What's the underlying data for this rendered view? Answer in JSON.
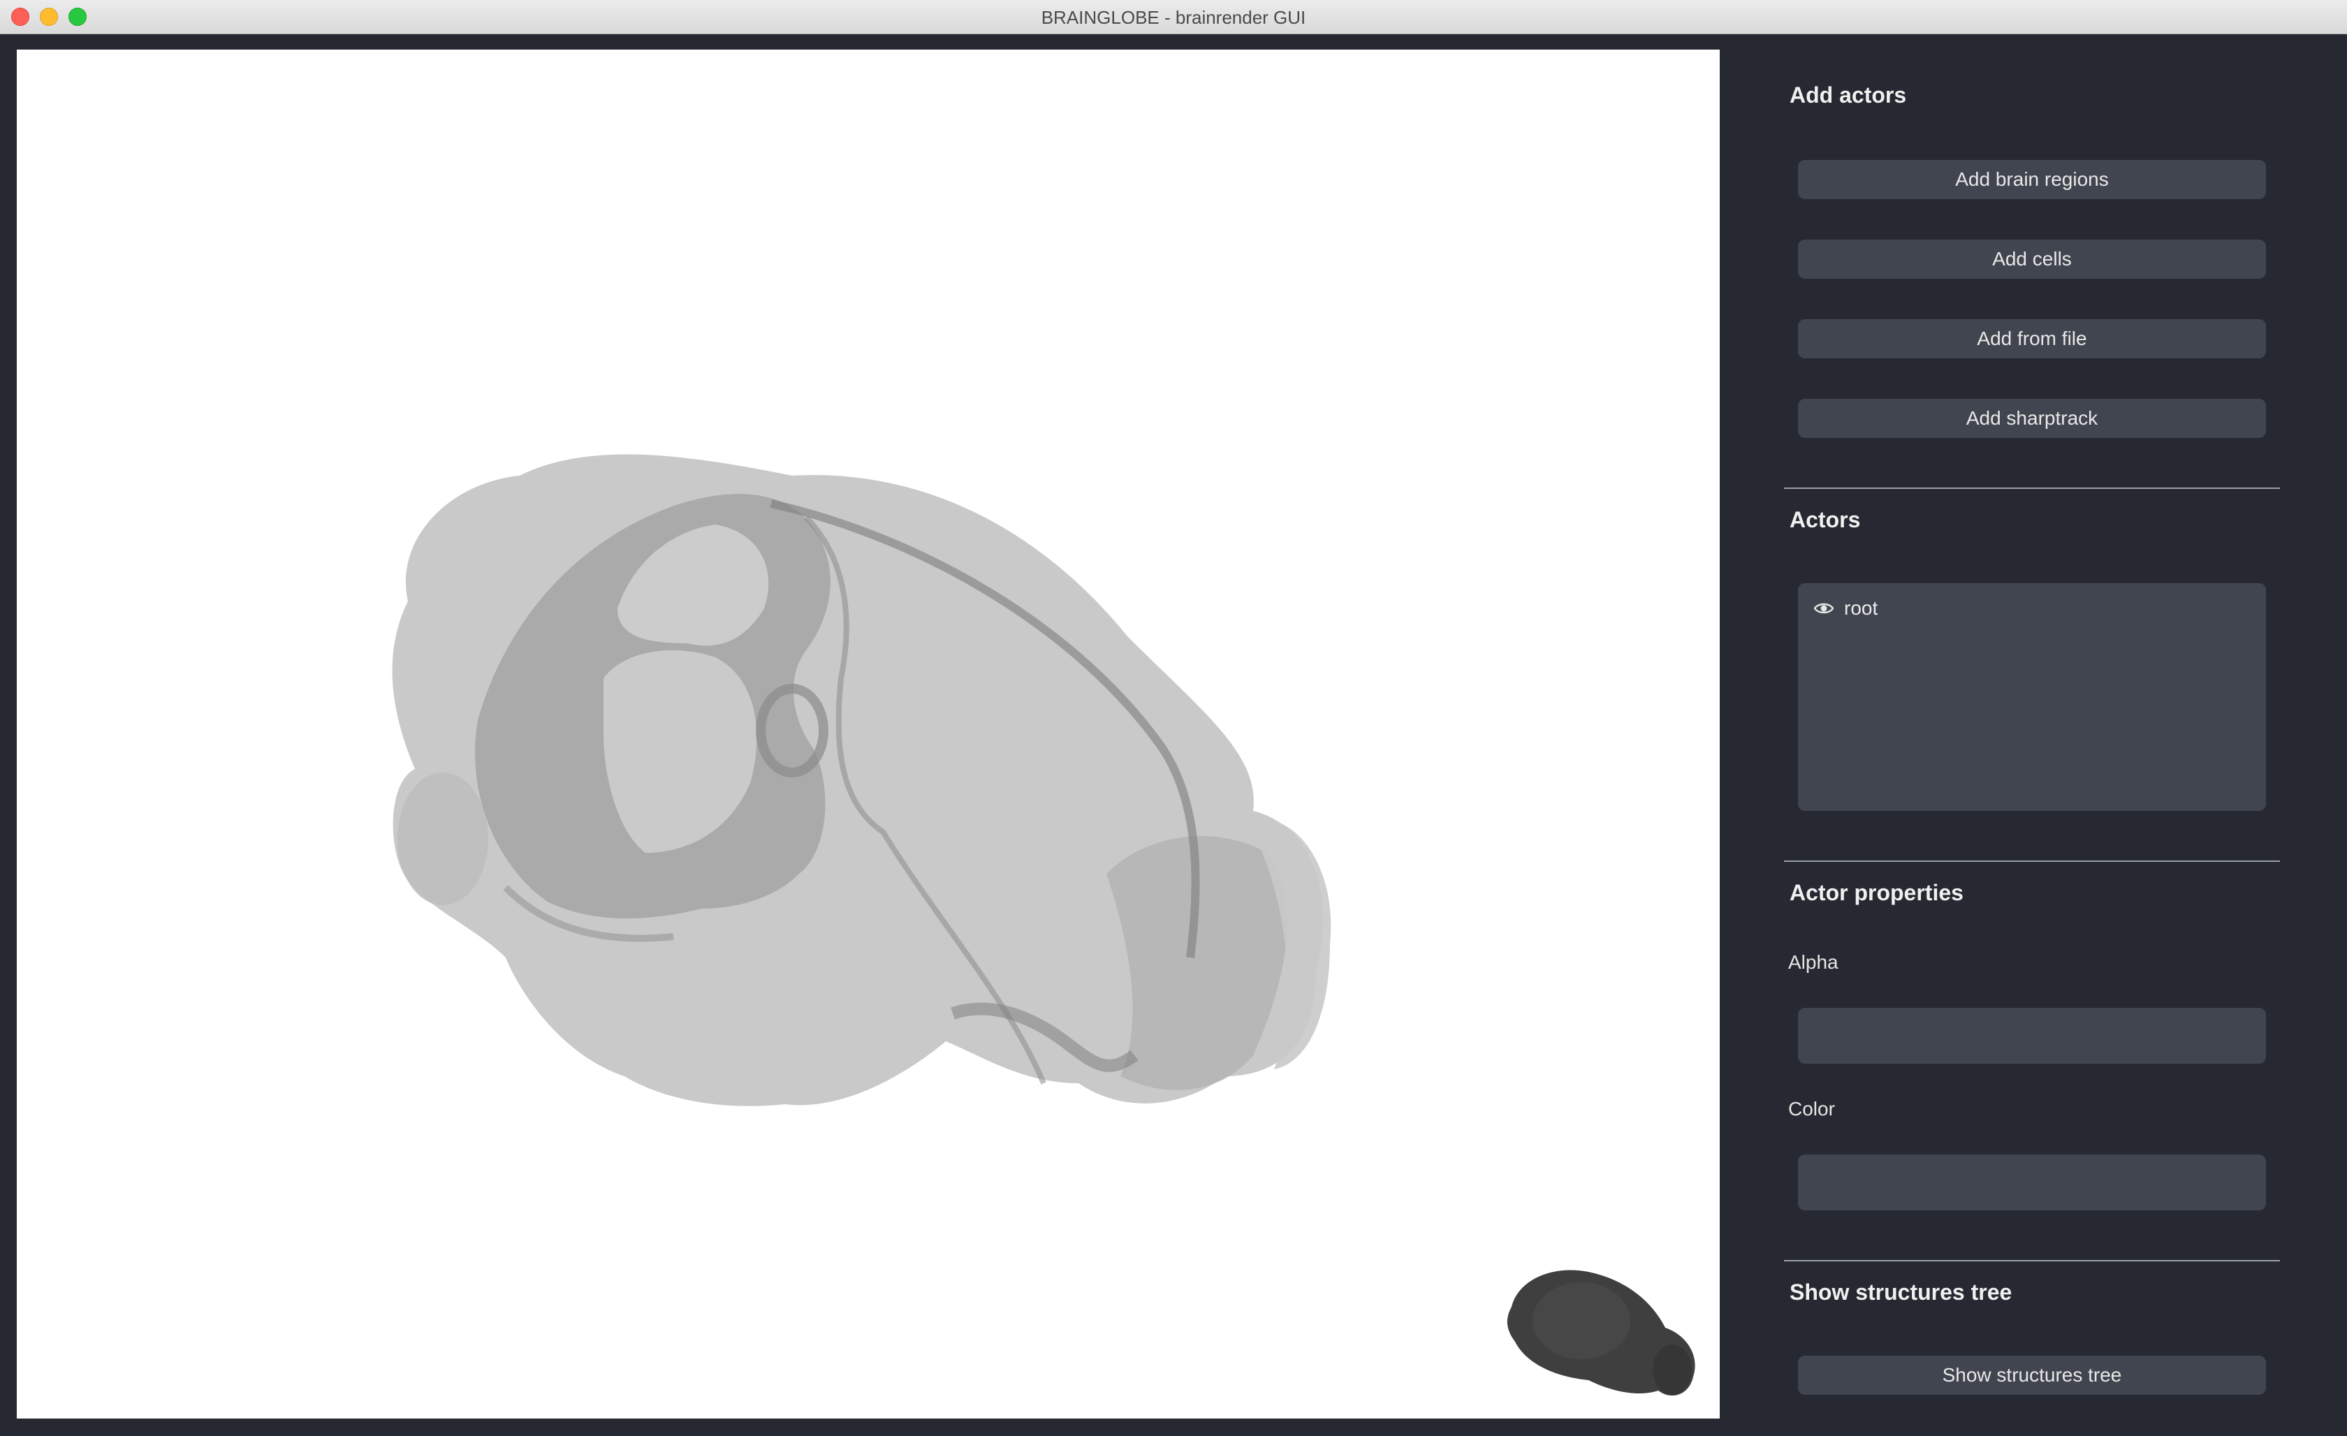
{
  "window": {
    "title": "BRAINGLOBE - brainrender GUI"
  },
  "panel": {
    "add_actors": {
      "title": "Add actors",
      "buttons": [
        "Add brain regions",
        "Add cells",
        "Add from file",
        "Add sharptrack"
      ]
    },
    "actors": {
      "title": "Actors",
      "items": [
        {
          "name": "root",
          "icon": "eye-icon"
        }
      ]
    },
    "actor_properties": {
      "title": "Actor properties",
      "alpha_label": "Alpha",
      "alpha_value": "",
      "color_label": "Color",
      "color_value": ""
    },
    "structures_tree": {
      "title": "Show structures tree",
      "button": "Show structures tree"
    }
  },
  "colors": {
    "panel_bg": "#262931",
    "widget_bg": "#414550",
    "viewport_bg": "#ffffff",
    "brain_mesh": "#c8c8c8",
    "orientation_marker": "#3f3f3f"
  }
}
